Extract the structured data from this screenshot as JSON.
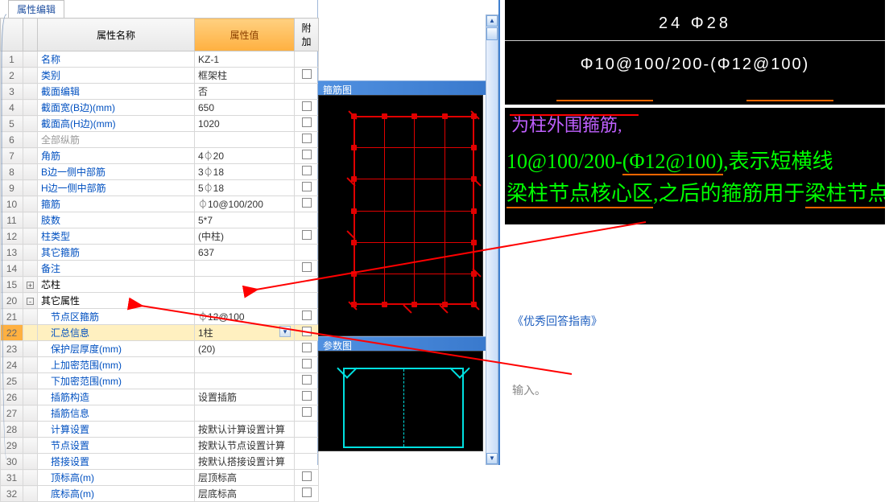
{
  "tabTitle": "属性编辑",
  "headers": {
    "name": "属性名称",
    "value": "属性值",
    "extra": "附加"
  },
  "rows": [
    {
      "num": "1",
      "name": "名称",
      "value": "KZ-1",
      "cls": "",
      "hasCheck": false
    },
    {
      "num": "2",
      "name": "类别",
      "value": "框架柱",
      "cls": "",
      "hasCheck": true
    },
    {
      "num": "3",
      "name": "截面编辑",
      "value": "否",
      "cls": "",
      "hasCheck": false
    },
    {
      "num": "4",
      "name": "截面宽(B边)(mm)",
      "value": "650",
      "cls": "",
      "hasCheck": true
    },
    {
      "num": "5",
      "name": "截面高(H边)(mm)",
      "value": "1020",
      "cls": "",
      "hasCheck": true
    },
    {
      "num": "6",
      "name": "全部纵筋",
      "value": "",
      "cls": "gray",
      "hasCheck": true
    },
    {
      "num": "7",
      "name": "角筋",
      "value": "4⏀20",
      "cls": "",
      "hasCheck": true
    },
    {
      "num": "8",
      "name": "B边一侧中部筋",
      "value": "3⏀18",
      "cls": "",
      "hasCheck": true
    },
    {
      "num": "9",
      "name": "H边一侧中部筋",
      "value": "5⏀18",
      "cls": "",
      "hasCheck": true
    },
    {
      "num": "10",
      "name": "箍筋",
      "value": "⏀10@100/200",
      "cls": "",
      "hasCheck": true
    },
    {
      "num": "11",
      "name": "肢数",
      "value": "5*7",
      "cls": "",
      "hasCheck": false
    },
    {
      "num": "12",
      "name": "柱类型",
      "value": "(中柱)",
      "cls": "",
      "hasCheck": true
    },
    {
      "num": "13",
      "name": "其它箍筋",
      "value": "637",
      "cls": "",
      "hasCheck": false
    },
    {
      "num": "14",
      "name": "备注",
      "value": "",
      "cls": "",
      "hasCheck": true
    },
    {
      "num": "15",
      "name": "芯柱",
      "value": "",
      "cls": "black",
      "hasCheck": false,
      "exp": "+"
    },
    {
      "num": "20",
      "name": "其它属性",
      "value": "",
      "cls": "black",
      "hasCheck": false,
      "exp": "-"
    },
    {
      "num": "21",
      "name": "节点区箍筋",
      "value": "⏀12@100",
      "cls": "",
      "hasCheck": true,
      "indent": true
    },
    {
      "num": "22",
      "name": "汇总信息",
      "value": "1柱",
      "cls": "",
      "hasCheck": true,
      "indent": true,
      "selected": true,
      "dropdown": true
    },
    {
      "num": "23",
      "name": "保护层厚度(mm)",
      "value": "(20)",
      "cls": "",
      "hasCheck": true,
      "indent": true
    },
    {
      "num": "24",
      "name": "上加密范围(mm)",
      "value": "",
      "cls": "",
      "hasCheck": true,
      "indent": true
    },
    {
      "num": "25",
      "name": "下加密范围(mm)",
      "value": "",
      "cls": "",
      "hasCheck": true,
      "indent": true
    },
    {
      "num": "26",
      "name": "插筋构造",
      "value": "设置插筋",
      "cls": "",
      "hasCheck": true,
      "indent": true
    },
    {
      "num": "27",
      "name": "插筋信息",
      "value": "",
      "cls": "",
      "hasCheck": true,
      "indent": true
    },
    {
      "num": "28",
      "name": "计算设置",
      "value": "按默认计算设置计算",
      "cls": "",
      "hasCheck": false,
      "indent": true
    },
    {
      "num": "29",
      "name": "节点设置",
      "value": "按默认节点设置计算",
      "cls": "",
      "hasCheck": false,
      "indent": true
    },
    {
      "num": "30",
      "name": "搭接设置",
      "value": "按默认搭接设置计算",
      "cls": "",
      "hasCheck": false,
      "indent": true
    },
    {
      "num": "31",
      "name": "顶标高(m)",
      "value": "层顶标高",
      "cls": "",
      "hasCheck": true,
      "indent": true
    },
    {
      "num": "32",
      "name": "底标高(m)",
      "value": "层底标高",
      "cls": "",
      "hasCheck": true,
      "indent": true
    }
  ],
  "midHeader1": "箍筋图",
  "midHeader2": "参数图",
  "cadTop1": "24 Φ28",
  "cadTop2": "Φ10@100/200-(Φ12@100)",
  "greenLine1a": "10@100/200-",
  "greenLine1b": "(Φ12@100)",
  "greenLine1c": ",表示短横线",
  "greenLine2a": "梁柱节点核心区",
  "greenLine2b": ",之后的箍筋用于",
  "greenLine2c": "梁柱节点核心区",
  "purpleFrag": "为柱外围箍筋,",
  "guideLink": "《优秀回答指南》",
  "inputHint": "输入。"
}
